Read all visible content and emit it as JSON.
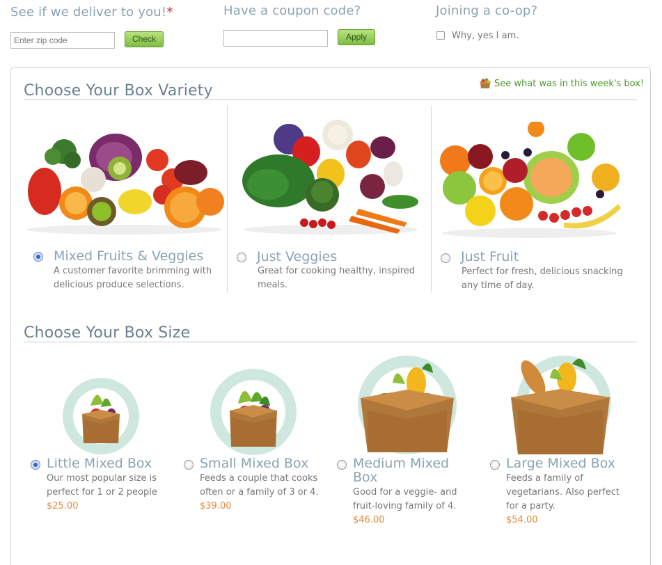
{
  "delivery": {
    "title": "See if we deliver to you!",
    "required_mark": "*",
    "zip_placeholder": "Enter zip code",
    "check_label": "Check"
  },
  "coupon": {
    "title": "Have a coupon code?",
    "value": "",
    "apply_label": "Apply"
  },
  "coop": {
    "title": "Joining a co-op?",
    "checkbox_label": "Why, yes I am.",
    "checked": false
  },
  "variety": {
    "title": "Choose Your Box Variety",
    "week_link": "See what was in this week's box!",
    "options": [
      {
        "title": "Mixed Fruits & Veggies",
        "desc_line1": "A customer favorite brimming with",
        "desc_line2": "delicious produce selections.",
        "selected": true,
        "image": "mixed-produce-photo"
      },
      {
        "title": "Just Veggies",
        "desc_line1": "Great for cooking healthy, inspired",
        "desc_line2": "meals.",
        "selected": false,
        "image": "vegetables-photo"
      },
      {
        "title": "Just Fruit",
        "desc_line1": "Perfect for fresh, delicious snacking",
        "desc_line2": "any time of day.",
        "selected": false,
        "image": "fruit-photo"
      }
    ]
  },
  "size": {
    "title": "Choose Your Box Size",
    "options": [
      {
        "title_line1": "Little Mixed Box",
        "title_line2": "",
        "desc_line1": "Our most popular size is",
        "desc_line2": "perfect for 1 or 2 people",
        "desc_line3": "",
        "price": "$25.00",
        "selected": true
      },
      {
        "title_line1": "Small Mixed Box",
        "title_line2": "",
        "desc_line1": "Feeds a couple that cooks",
        "desc_line2": "often or a family of 3 or 4.",
        "desc_line3": "",
        "price": "$39.00",
        "selected": false
      },
      {
        "title_line1": "Medium Mixed",
        "title_line2": "Box",
        "desc_line1": "Good for a veggie- and",
        "desc_line2": "fruit-loving family of 4.",
        "desc_line3": "",
        "price": "$46.00",
        "selected": false
      },
      {
        "title_line1": "Large Mixed Box",
        "title_line2": "",
        "desc_line1": "Feeds a family of",
        "desc_line2": "vegetarians. Also perfect",
        "desc_line3": "for a party.",
        "price": "$54.00",
        "selected": false
      }
    ]
  },
  "colors": {
    "heading": "#6b8190",
    "option_title": "#8aa3b3",
    "price": "#e38a3b",
    "link": "#4a9a2a",
    "required": "#d9262c",
    "button_green": "#7fbd43",
    "circle_mint": "#cfe8df"
  }
}
